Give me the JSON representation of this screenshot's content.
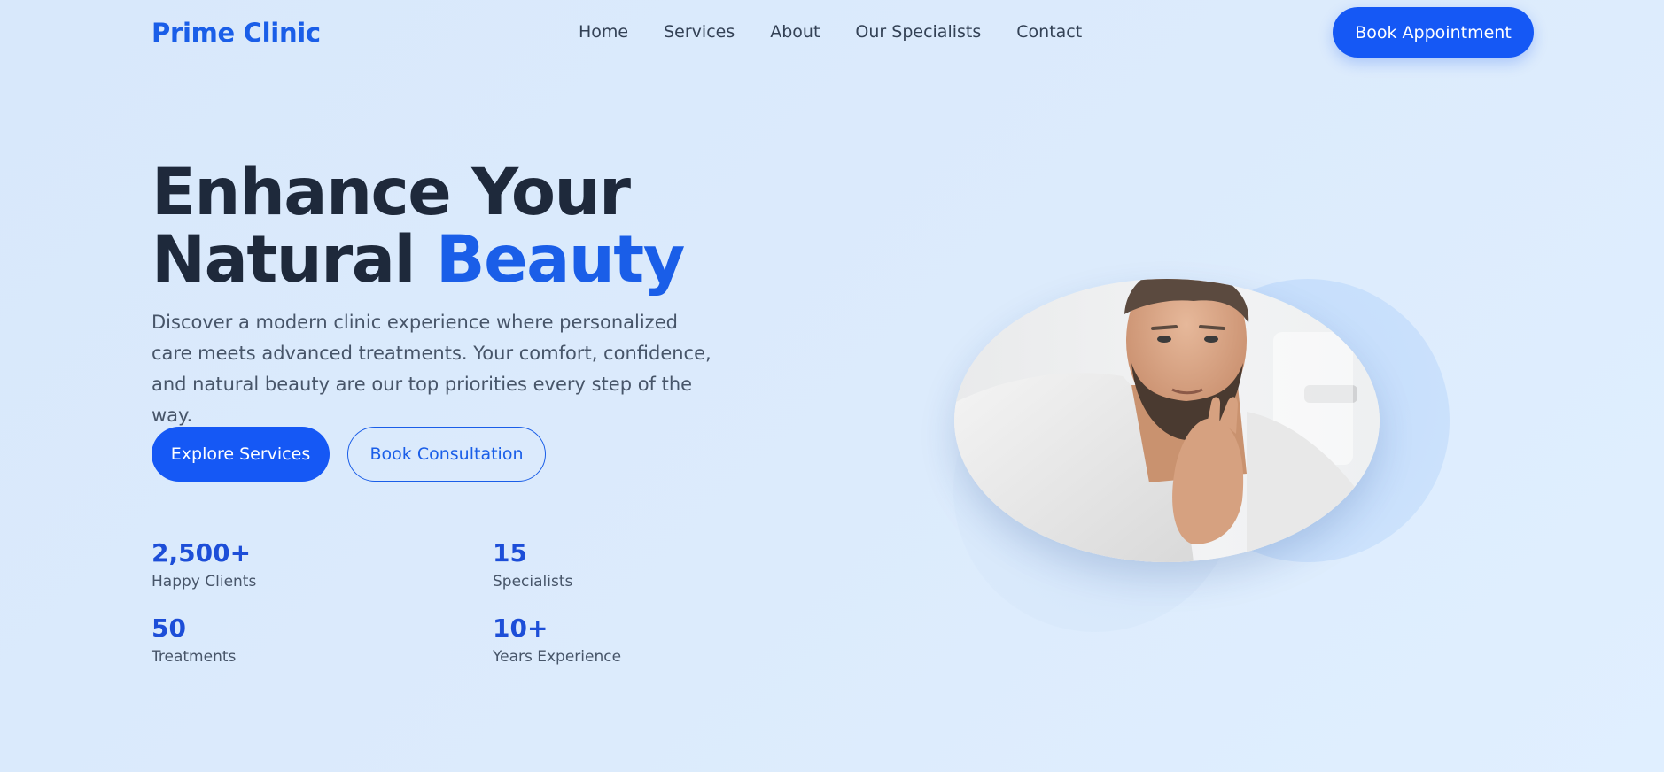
{
  "brand": {
    "logo": "Prime Clinic",
    "accent_color": "#1a5ee8"
  },
  "nav": {
    "items": [
      "Home",
      "Services",
      "About",
      "Our Specialists",
      "Contact"
    ],
    "cta": "Book Appointment"
  },
  "hero": {
    "title_line1": "Enhance Your",
    "title_line2_plain": "Natural ",
    "title_line2_accent": "Beauty",
    "description": "Discover a modern clinic experience where personalized care meets advanced treatments. Your comfort, confidence, and natural beauty are our top priorities every step of the way.",
    "primary_button": "Explore Services",
    "secondary_button": "Book Consultation"
  },
  "stats": [
    {
      "value": "2,500+",
      "label": "Happy Clients"
    },
    {
      "value": "15",
      "label": "Specialists"
    },
    {
      "value": "50",
      "label": "Treatments"
    },
    {
      "value": "10+",
      "label": "Years Experience"
    }
  ]
}
